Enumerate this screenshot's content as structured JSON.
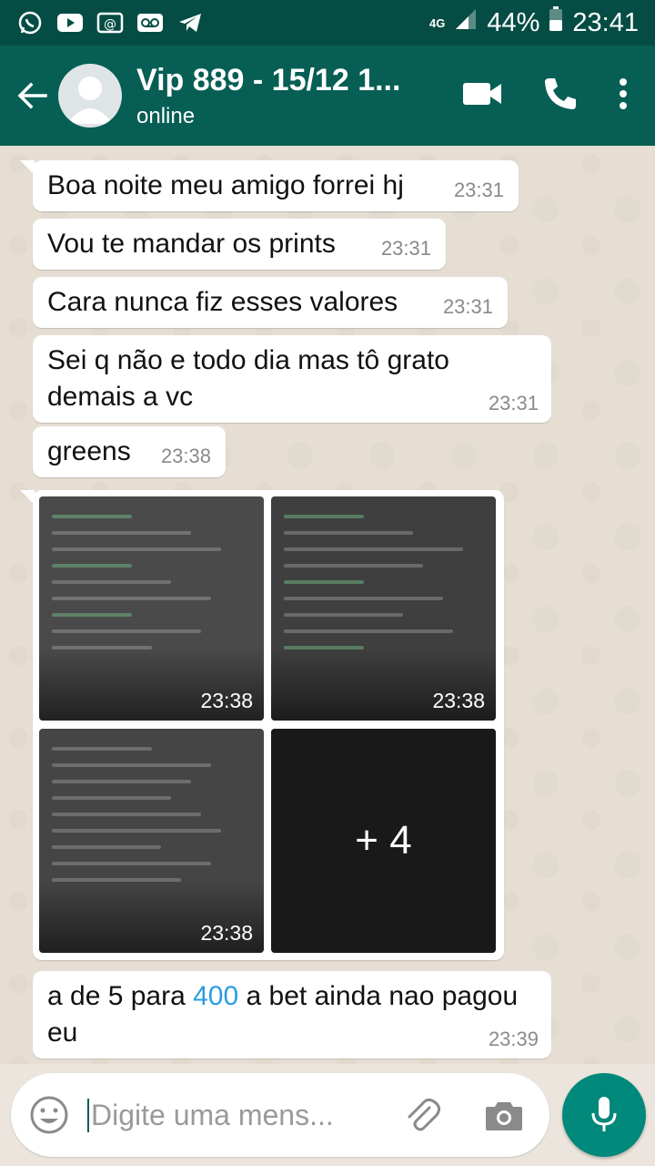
{
  "statusbar": {
    "network": "4G",
    "battery": "44%",
    "time": "23:41",
    "icons": [
      "whatsapp-icon",
      "youtube-icon",
      "email-icon",
      "voicemail-icon",
      "telegram-icon"
    ]
  },
  "header": {
    "name": "Vip 889 - 15/12 1...",
    "status": "online"
  },
  "messages": [
    {
      "text": "Boa noite meu amigo forrei hj",
      "time": "23:31"
    },
    {
      "text": "Vou te mandar os prints",
      "time": "23:31"
    },
    {
      "text": "Cara nunca fiz esses valores",
      "time": "23:31"
    },
    {
      "text": "Sei q não e todo dia mas tô grato demais a vc",
      "time": "23:31"
    },
    {
      "text": "greens",
      "time": "23:38"
    }
  ],
  "media": {
    "thumbs": [
      {
        "time": "23:38"
      },
      {
        "time": "23:38"
      },
      {
        "time": "23:38"
      }
    ],
    "more_label": "+ 4"
  },
  "last_message": {
    "before": "a de 5 para ",
    "highlight": "400",
    "after": " a bet ainda nao pagou eu",
    "time": "23:39"
  },
  "input": {
    "placeholder": "Digite uma mens..."
  },
  "colors": {
    "header": "#075e54",
    "statusbar": "#054d44",
    "mic": "#00897b",
    "link": "#2a9ee0"
  }
}
